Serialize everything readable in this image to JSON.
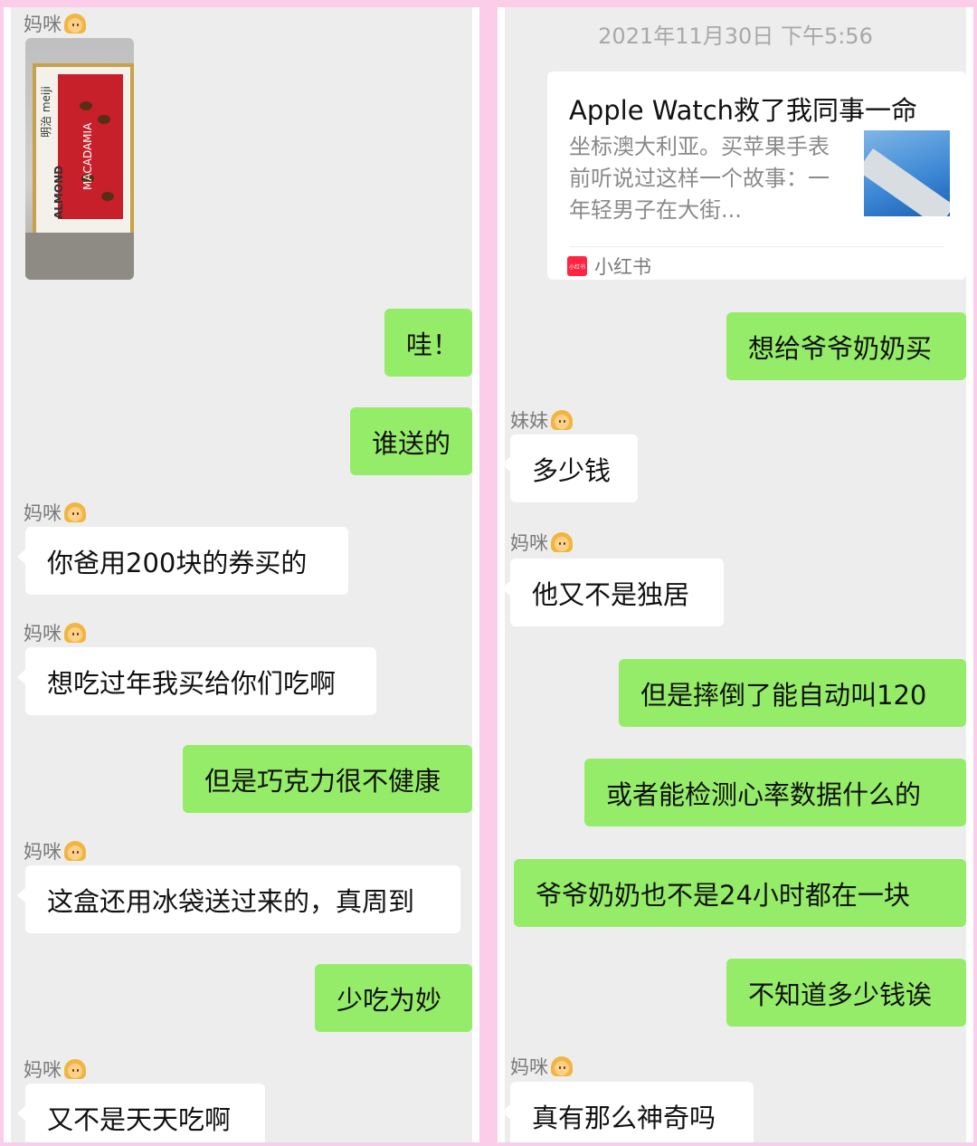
{
  "left_panel": {
    "messages": [
      {
        "type": "incoming",
        "sender": "妈咪",
        "kind": "image"
      },
      {
        "type": "outgoing",
        "text": "哇！"
      },
      {
        "type": "outgoing",
        "text": "谁送的"
      },
      {
        "type": "incoming",
        "sender": "妈咪",
        "text": "你爸用200块的券买的"
      },
      {
        "type": "incoming",
        "sender": "妈咪",
        "text": "想吃过年我买给你们吃啊"
      },
      {
        "type": "outgoing",
        "text": "但是巧克力很不健康"
      },
      {
        "type": "incoming",
        "sender": "妈咪",
        "text": "这盒还用冰袋送过来的，真周到"
      },
      {
        "type": "outgoing",
        "text": "少吃为妙"
      },
      {
        "type": "incoming",
        "sender": "妈咪",
        "text": "又不是天天吃啊"
      }
    ],
    "photo": {
      "brand": "明治 meiji",
      "product_left": "ALMOND",
      "product_right": "MACADAMIA"
    }
  },
  "right_panel": {
    "timestamp": "2021年11月30日 下午5:56",
    "link_card": {
      "title": "Apple Watch救了我同事一命",
      "description": "坐标澳大利亚。买苹果手表前听说过这样一个故事：一年轻男子在大街...",
      "source": "小红书",
      "source_icon_text": "小红书"
    },
    "messages": [
      {
        "type": "outgoing",
        "text": "想给爷爷奶奶买"
      },
      {
        "type": "incoming",
        "sender": "妹妹",
        "text": "多少钱"
      },
      {
        "type": "incoming",
        "sender": "妈咪",
        "text": "他又不是独居"
      },
      {
        "type": "outgoing",
        "text": "但是摔倒了能自动叫120"
      },
      {
        "type": "outgoing",
        "text": "或者能检测心率数据什么的"
      },
      {
        "type": "outgoing",
        "text": "爷爷奶奶也不是24小时都在一块"
      },
      {
        "type": "outgoing",
        "text": "不知道多少钱诶"
      },
      {
        "type": "incoming",
        "sender": "妈咪",
        "text": "真有那么神奇吗"
      }
    ]
  },
  "colors": {
    "outgoing_bubble": "#95ec69",
    "incoming_bubble": "#ffffff",
    "chat_background": "#ededed",
    "frame": "#fbcde9"
  }
}
